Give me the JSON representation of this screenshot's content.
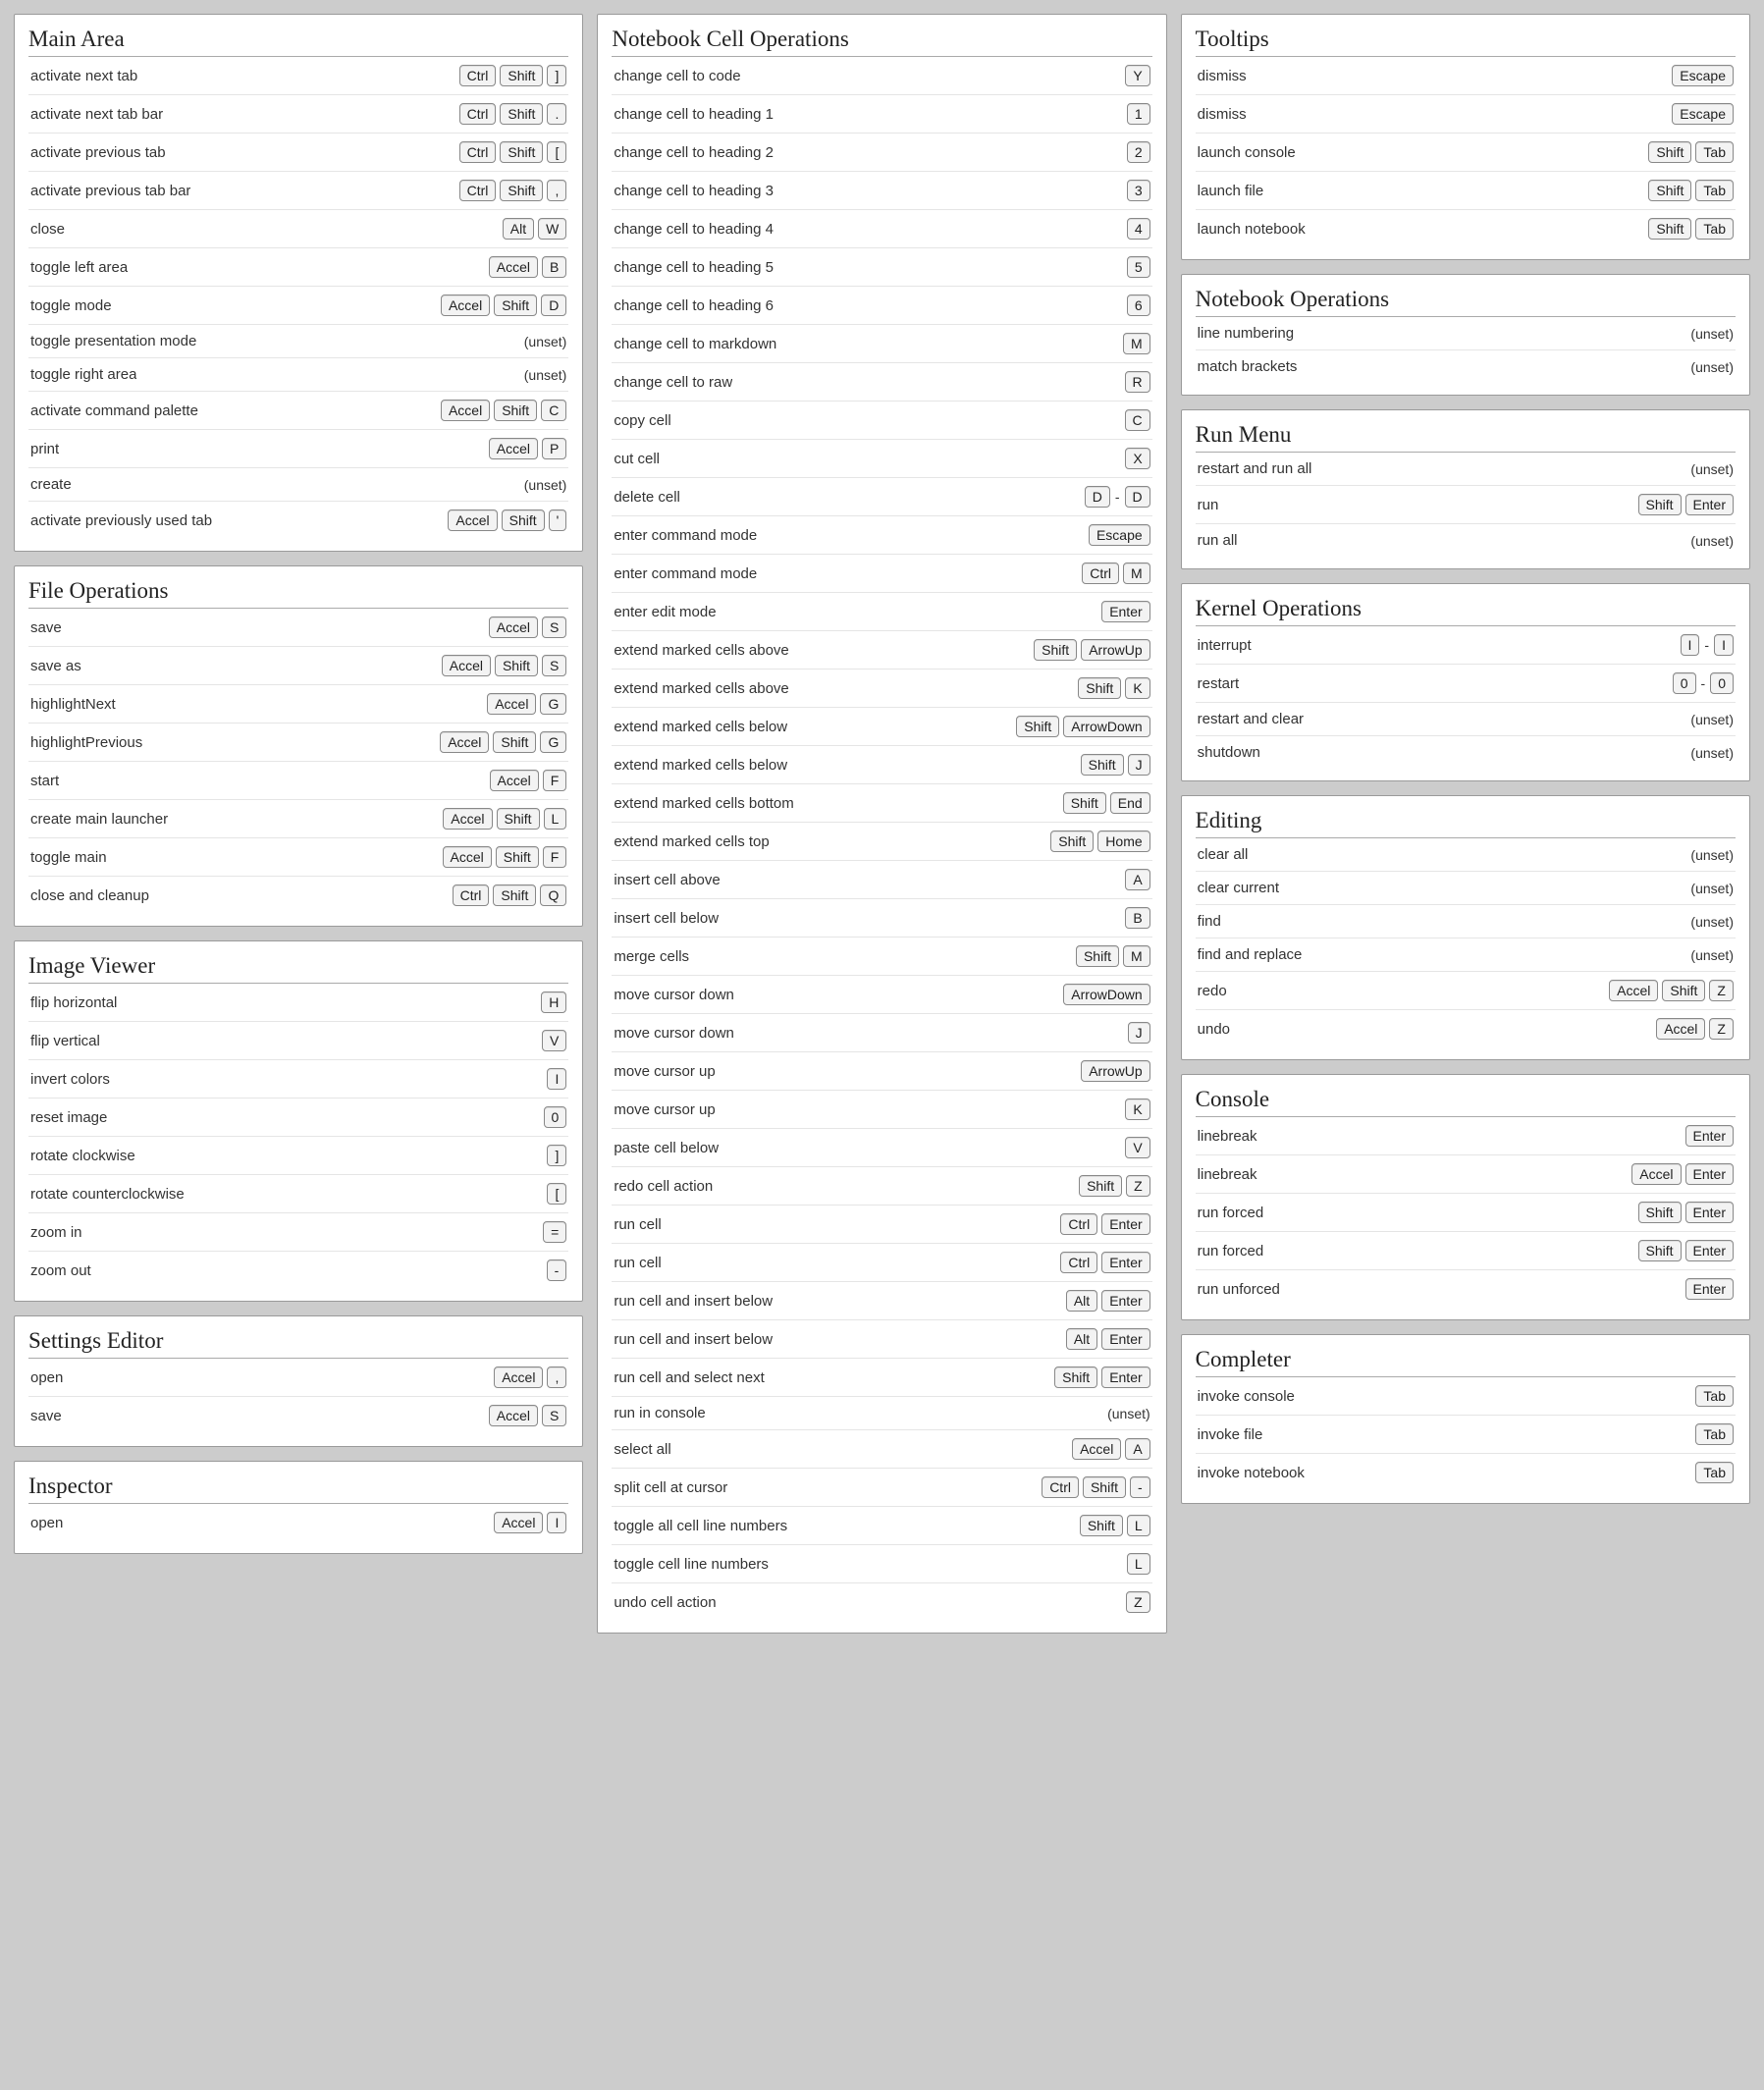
{
  "unset_label": "(unset)",
  "sep_label": "-",
  "columns": [
    [
      {
        "title": "Main Area",
        "rows": [
          {
            "label": "activate next tab",
            "keys": [
              [
                "Ctrl",
                "Shift",
                "]"
              ]
            ]
          },
          {
            "label": "activate next tab bar",
            "keys": [
              [
                "Ctrl",
                "Shift",
                "."
              ]
            ]
          },
          {
            "label": "activate previous tab",
            "keys": [
              [
                "Ctrl",
                "Shift",
                "["
              ]
            ]
          },
          {
            "label": "activate previous tab bar",
            "keys": [
              [
                "Ctrl",
                "Shift",
                ","
              ]
            ]
          },
          {
            "label": "close",
            "keys": [
              [
                "Alt",
                "W"
              ]
            ]
          },
          {
            "label": "toggle left area",
            "keys": [
              [
                "Accel",
                "B"
              ]
            ]
          },
          {
            "label": "toggle mode",
            "keys": [
              [
                "Accel",
                "Shift",
                "D"
              ]
            ]
          },
          {
            "label": "toggle presentation mode",
            "unset": true
          },
          {
            "label": "toggle right area",
            "unset": true
          },
          {
            "label": "activate command palette",
            "keys": [
              [
                "Accel",
                "Shift",
                "C"
              ]
            ]
          },
          {
            "label": "print",
            "keys": [
              [
                "Accel",
                "P"
              ]
            ]
          },
          {
            "label": "create",
            "unset": true
          },
          {
            "label": "activate previously used tab",
            "keys": [
              [
                "Accel",
                "Shift",
                "'"
              ]
            ]
          }
        ]
      },
      {
        "title": "File Operations",
        "rows": [
          {
            "label": "save",
            "keys": [
              [
                "Accel",
                "S"
              ]
            ]
          },
          {
            "label": "save as",
            "keys": [
              [
                "Accel",
                "Shift",
                "S"
              ]
            ]
          },
          {
            "label": "highlightNext",
            "keys": [
              [
                "Accel",
                "G"
              ]
            ]
          },
          {
            "label": "highlightPrevious",
            "keys": [
              [
                "Accel",
                "Shift",
                "G"
              ]
            ]
          },
          {
            "label": "start",
            "keys": [
              [
                "Accel",
                "F"
              ]
            ]
          },
          {
            "label": "create main launcher",
            "keys": [
              [
                "Accel",
                "Shift",
                "L"
              ]
            ]
          },
          {
            "label": "toggle main",
            "keys": [
              [
                "Accel",
                "Shift",
                "F"
              ]
            ]
          },
          {
            "label": "close and cleanup",
            "keys": [
              [
                "Ctrl",
                "Shift",
                "Q"
              ]
            ]
          }
        ]
      },
      {
        "title": "Image Viewer",
        "rows": [
          {
            "label": "flip horizontal",
            "keys": [
              [
                "H"
              ]
            ]
          },
          {
            "label": "flip vertical",
            "keys": [
              [
                "V"
              ]
            ]
          },
          {
            "label": "invert colors",
            "keys": [
              [
                "I"
              ]
            ]
          },
          {
            "label": "reset image",
            "keys": [
              [
                "0"
              ]
            ]
          },
          {
            "label": "rotate clockwise",
            "keys": [
              [
                "]"
              ]
            ]
          },
          {
            "label": "rotate counterclockwise",
            "keys": [
              [
                "["
              ]
            ]
          },
          {
            "label": "zoom in",
            "keys": [
              [
                "="
              ]
            ]
          },
          {
            "label": "zoom out",
            "keys": [
              [
                "-"
              ]
            ]
          }
        ]
      },
      {
        "title": "Settings Editor",
        "rows": [
          {
            "label": "open",
            "keys": [
              [
                "Accel",
                ","
              ]
            ]
          },
          {
            "label": "save",
            "keys": [
              [
                "Accel",
                "S"
              ]
            ]
          }
        ]
      },
      {
        "title": "Inspector",
        "rows": [
          {
            "label": "open",
            "keys": [
              [
                "Accel",
                "I"
              ]
            ]
          }
        ]
      }
    ],
    [
      {
        "title": "Notebook Cell Operations",
        "rows": [
          {
            "label": "change cell to code",
            "keys": [
              [
                "Y"
              ]
            ]
          },
          {
            "label": "change cell to heading 1",
            "keys": [
              [
                "1"
              ]
            ]
          },
          {
            "label": "change cell to heading 2",
            "keys": [
              [
                "2"
              ]
            ]
          },
          {
            "label": "change cell to heading 3",
            "keys": [
              [
                "3"
              ]
            ]
          },
          {
            "label": "change cell to heading 4",
            "keys": [
              [
                "4"
              ]
            ]
          },
          {
            "label": "change cell to heading 5",
            "keys": [
              [
                "5"
              ]
            ]
          },
          {
            "label": "change cell to heading 6",
            "keys": [
              [
                "6"
              ]
            ]
          },
          {
            "label": "change cell to markdown",
            "keys": [
              [
                "M"
              ]
            ]
          },
          {
            "label": "change cell to raw",
            "keys": [
              [
                "R"
              ]
            ]
          },
          {
            "label": "copy cell",
            "keys": [
              [
                "C"
              ]
            ]
          },
          {
            "label": "cut cell",
            "keys": [
              [
                "X"
              ]
            ]
          },
          {
            "label": "delete cell",
            "keys": [
              [
                "D"
              ],
              [
                "D"
              ]
            ]
          },
          {
            "label": "enter command mode",
            "keys": [
              [
                "Escape"
              ]
            ]
          },
          {
            "label": "enter command mode",
            "keys": [
              [
                "Ctrl",
                "M"
              ]
            ]
          },
          {
            "label": "enter edit mode",
            "keys": [
              [
                "Enter"
              ]
            ]
          },
          {
            "label": "extend marked cells above",
            "keys": [
              [
                "Shift",
                "ArrowUp"
              ]
            ]
          },
          {
            "label": "extend marked cells above",
            "keys": [
              [
                "Shift",
                "K"
              ]
            ]
          },
          {
            "label": "extend marked cells below",
            "keys": [
              [
                "Shift",
                "ArrowDown"
              ]
            ]
          },
          {
            "label": "extend marked cells below",
            "keys": [
              [
                "Shift",
                "J"
              ]
            ]
          },
          {
            "label": "extend marked cells bottom",
            "keys": [
              [
                "Shift",
                "End"
              ]
            ]
          },
          {
            "label": "extend marked cells top",
            "keys": [
              [
                "Shift",
                "Home"
              ]
            ]
          },
          {
            "label": "insert cell above",
            "keys": [
              [
                "A"
              ]
            ]
          },
          {
            "label": "insert cell below",
            "keys": [
              [
                "B"
              ]
            ]
          },
          {
            "label": "merge cells",
            "keys": [
              [
                "Shift",
                "M"
              ]
            ]
          },
          {
            "label": "move cursor down",
            "keys": [
              [
                "ArrowDown"
              ]
            ]
          },
          {
            "label": "move cursor down",
            "keys": [
              [
                "J"
              ]
            ]
          },
          {
            "label": "move cursor up",
            "keys": [
              [
                "ArrowUp"
              ]
            ]
          },
          {
            "label": "move cursor up",
            "keys": [
              [
                "K"
              ]
            ]
          },
          {
            "label": "paste cell below",
            "keys": [
              [
                "V"
              ]
            ]
          },
          {
            "label": "redo cell action",
            "keys": [
              [
                "Shift",
                "Z"
              ]
            ]
          },
          {
            "label": "run cell",
            "keys": [
              [
                "Ctrl",
                "Enter"
              ]
            ]
          },
          {
            "label": "run cell",
            "keys": [
              [
                "Ctrl",
                "Enter"
              ]
            ]
          },
          {
            "label": "run cell and insert below",
            "keys": [
              [
                "Alt",
                "Enter"
              ]
            ]
          },
          {
            "label": "run cell and insert below",
            "keys": [
              [
                "Alt",
                "Enter"
              ]
            ]
          },
          {
            "label": "run cell and select next",
            "keys": [
              [
                "Shift",
                "Enter"
              ]
            ]
          },
          {
            "label": "run in console",
            "unset": true
          },
          {
            "label": "select all",
            "keys": [
              [
                "Accel",
                "A"
              ]
            ]
          },
          {
            "label": "split cell at cursor",
            "keys": [
              [
                "Ctrl",
                "Shift",
                "-"
              ]
            ]
          },
          {
            "label": "toggle all cell line numbers",
            "keys": [
              [
                "Shift",
                "L"
              ]
            ]
          },
          {
            "label": "toggle cell line numbers",
            "keys": [
              [
                "L"
              ]
            ]
          },
          {
            "label": "undo cell action",
            "keys": [
              [
                "Z"
              ]
            ]
          }
        ]
      }
    ],
    [
      {
        "title": "Tooltips",
        "rows": [
          {
            "label": "dismiss",
            "keys": [
              [
                "Escape"
              ]
            ]
          },
          {
            "label": "dismiss",
            "keys": [
              [
                "Escape"
              ]
            ]
          },
          {
            "label": "launch console",
            "keys": [
              [
                "Shift",
                "Tab"
              ]
            ]
          },
          {
            "label": "launch file",
            "keys": [
              [
                "Shift",
                "Tab"
              ]
            ]
          },
          {
            "label": "launch notebook",
            "keys": [
              [
                "Shift",
                "Tab"
              ]
            ]
          }
        ]
      },
      {
        "title": "Notebook Operations",
        "rows": [
          {
            "label": "line numbering",
            "unset": true
          },
          {
            "label": "match brackets",
            "unset": true
          }
        ]
      },
      {
        "title": "Run Menu",
        "rows": [
          {
            "label": "restart and run all",
            "unset": true
          },
          {
            "label": "run",
            "keys": [
              [
                "Shift",
                "Enter"
              ]
            ]
          },
          {
            "label": "run all",
            "unset": true
          }
        ]
      },
      {
        "title": "Kernel Operations",
        "rows": [
          {
            "label": "interrupt",
            "keys": [
              [
                "I"
              ],
              [
                "I"
              ]
            ]
          },
          {
            "label": "restart",
            "keys": [
              [
                "0"
              ],
              [
                "0"
              ]
            ]
          },
          {
            "label": "restart and clear",
            "unset": true
          },
          {
            "label": "shutdown",
            "unset": true
          }
        ]
      },
      {
        "title": "Editing",
        "rows": [
          {
            "label": "clear all",
            "unset": true
          },
          {
            "label": "clear current",
            "unset": true
          },
          {
            "label": "find",
            "unset": true
          },
          {
            "label": "find and replace",
            "unset": true
          },
          {
            "label": "redo",
            "keys": [
              [
                "Accel",
                "Shift",
                "Z"
              ]
            ]
          },
          {
            "label": "undo",
            "keys": [
              [
                "Accel",
                "Z"
              ]
            ]
          }
        ]
      },
      {
        "title": "Console",
        "rows": [
          {
            "label": "linebreak",
            "keys": [
              [
                "Enter"
              ]
            ]
          },
          {
            "label": "linebreak",
            "keys": [
              [
                "Accel",
                "Enter"
              ]
            ]
          },
          {
            "label": "run forced",
            "keys": [
              [
                "Shift",
                "Enter"
              ]
            ]
          },
          {
            "label": "run forced",
            "keys": [
              [
                "Shift",
                "Enter"
              ]
            ]
          },
          {
            "label": "run unforced",
            "keys": [
              [
                "Enter"
              ]
            ]
          }
        ]
      },
      {
        "title": "Completer",
        "rows": [
          {
            "label": "invoke console",
            "keys": [
              [
                "Tab"
              ]
            ]
          },
          {
            "label": "invoke file",
            "keys": [
              [
                "Tab"
              ]
            ]
          },
          {
            "label": "invoke notebook",
            "keys": [
              [
                "Tab"
              ]
            ]
          }
        ]
      }
    ]
  ]
}
